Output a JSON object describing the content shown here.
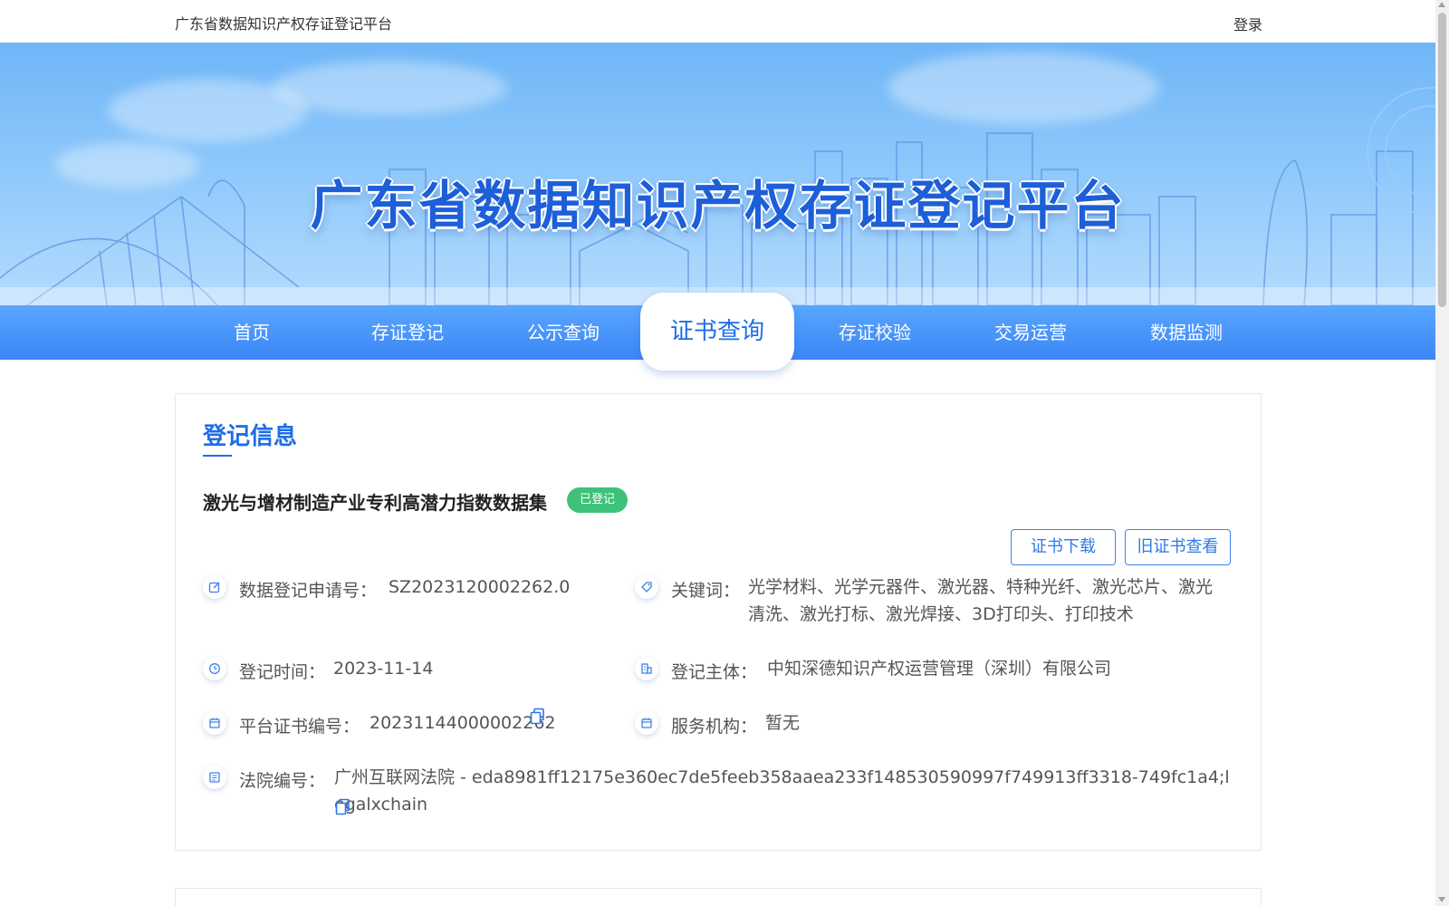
{
  "topbar": {
    "site_name": "广东省数据知识产权存证登记平台",
    "login_label": "登录"
  },
  "banner": {
    "title": "广东省数据知识产权存证登记平台"
  },
  "nav": {
    "items": [
      "首页",
      "存证登记",
      "公示查询",
      "证书查询",
      "存证校验",
      "交易运营",
      "数据监测"
    ],
    "active_index": 3
  },
  "card": {
    "section_title": "登记信息",
    "dataset_name": "激光与增材制造产业专利高潜力指数数据集",
    "status_badge": "已登记",
    "buttons": {
      "download": "证书下载",
      "old_view": "旧证书查看"
    },
    "fields": {
      "apply_no_label": "数据登记申请号：",
      "apply_no_value": "SZ2023120002262.0",
      "keywords_label": "关键词：",
      "keywords_value": "光学材料、光学元器件、激光器、特种光纤、激光芯片、激光清洗、激光打标、激光焊接、3D打印头、打印技术",
      "time_label": "登记时间：",
      "time_value": "2023-11-14",
      "subject_label": "登记主体：",
      "subject_value": "中知深德知识产权运营管理（深圳）有限公司",
      "cert_no_label": "平台证书编号：",
      "cert_no_value": "20231144000002262",
      "agency_label": "服务机构：",
      "agency_value": "暂无",
      "court_label": "法院编号：",
      "court_value": "广州互联网法院 - eda8981ff12175e360ec7de5feeb358aaea233f148530590997f749913ff3318-749fc1a4;legalxchain"
    }
  },
  "colors": {
    "accent": "#1e6de8",
    "nav": "#3b86f5",
    "badge": "#3ec27a"
  },
  "icons": [
    "edit-icon",
    "tag-icon",
    "clock-icon",
    "building-icon",
    "calendar-icon",
    "form-icon",
    "copy-icon"
  ]
}
